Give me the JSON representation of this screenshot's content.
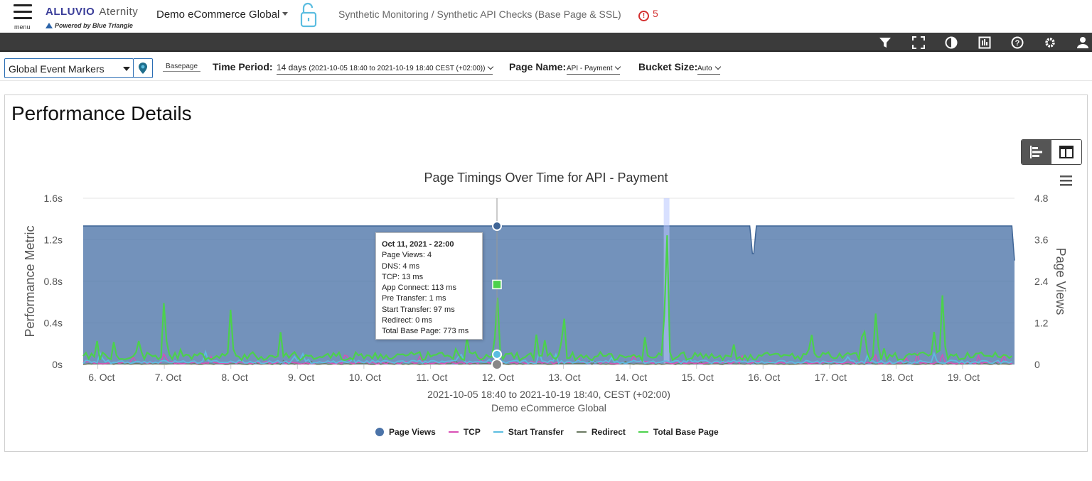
{
  "header": {
    "menu_label": "menu",
    "logo_primary": "ALLUVIO",
    "logo_secondary": "Aternity",
    "powered_by": "Powered by Blue Triangle",
    "app_name": "Demo eCommerce Global",
    "breadcrumb": "Synthetic Monitoring / Synthetic API Checks (Base Page & SSL)",
    "alert_count": "5"
  },
  "toolbar": {
    "icons": [
      "filter-icon",
      "fullscreen-icon",
      "contrast-icon",
      "report-icon",
      "help-icon",
      "gear-icon",
      "user-icon"
    ]
  },
  "filters": {
    "event_markers": "Global Event Markers",
    "basepage_label": "Basepage",
    "time_period_label": "Time Period:",
    "time_period_value": "14 days",
    "time_period_range": "(2021-10-05 18:40 to 2021-10-19 18:40 CEST (+02:00))",
    "page_name_label": "Page Name:",
    "page_name_value": "API - Payment",
    "bucket_size_label": "Bucket Size:",
    "bucket_size_value": "Auto"
  },
  "panel": {
    "title": "Performance Details"
  },
  "tooltip": {
    "title": "Oct 11, 2021 - 22:00",
    "lines": [
      "Page Views: 4",
      "DNS: 4 ms",
      "TCP: 13 ms",
      "App Connect: 113 ms",
      "Pre Transfer: 1 ms",
      "Start Transfer: 97 ms",
      "Redirect: 0 ms",
      "Total Base Page: 773 ms"
    ]
  },
  "chart_data": {
    "type": "area",
    "title": "Page Timings Over Time for API - Payment",
    "ylabel": "Performance Metric",
    "y2label": "Page Views",
    "xlabel": "2021-10-05 18:40 to 2021-10-19 18:40, CEST (+02:00)",
    "xsublabel": "Demo eCommerce Global",
    "ylim": [
      0,
      1.6
    ],
    "y2lim": [
      0,
      4.8
    ],
    "yticks": [
      "0s",
      "0.4s",
      "0.8s",
      "1.2s",
      "1.6s"
    ],
    "y2ticks": [
      "0",
      "1.2",
      "2.4",
      "3.6",
      "4.8"
    ],
    "xticks": [
      "6. Oct",
      "7. Oct",
      "8. Oct",
      "9. Oct",
      "10. Oct",
      "11. Oct",
      "12. Oct",
      "13. Oct",
      "14. Oct",
      "15. Oct",
      "16. Oct",
      "17. Oct",
      "18. Oct",
      "19. Oct"
    ],
    "series": [
      {
        "name": "Page Views",
        "color": "#4b73a8",
        "axis": "y2",
        "baseline": 4,
        "dips": [
          {
            "day": 15.85,
            "value": 3
          },
          {
            "day": 19.85,
            "value": 3
          }
        ]
      },
      {
        "name": "TCP",
        "color": "#d94fb5",
        "peak_ms": 120
      },
      {
        "name": "Start Transfer",
        "color": "#5bbde0",
        "peak_ms": 160
      },
      {
        "name": "Redirect",
        "color": "#6b7a62",
        "peak_ms": 10
      },
      {
        "name": "Total Base Page",
        "color": "#4cd14c",
        "peaks": [
          {
            "day": 7.0,
            "value": 0.7
          },
          {
            "day": 8.0,
            "value": 0.58
          },
          {
            "day": 12.0,
            "value": 0.77
          },
          {
            "day": 13.0,
            "value": 0.57
          },
          {
            "day": 14.55,
            "value": 1.48
          },
          {
            "day": 17.7,
            "value": 0.57
          },
          {
            "day": 18.7,
            "value": 0.72
          }
        ]
      }
    ],
    "tooltip_day": 12.0,
    "event_marker_day": 14.55,
    "legend_position": "bottom-center"
  }
}
